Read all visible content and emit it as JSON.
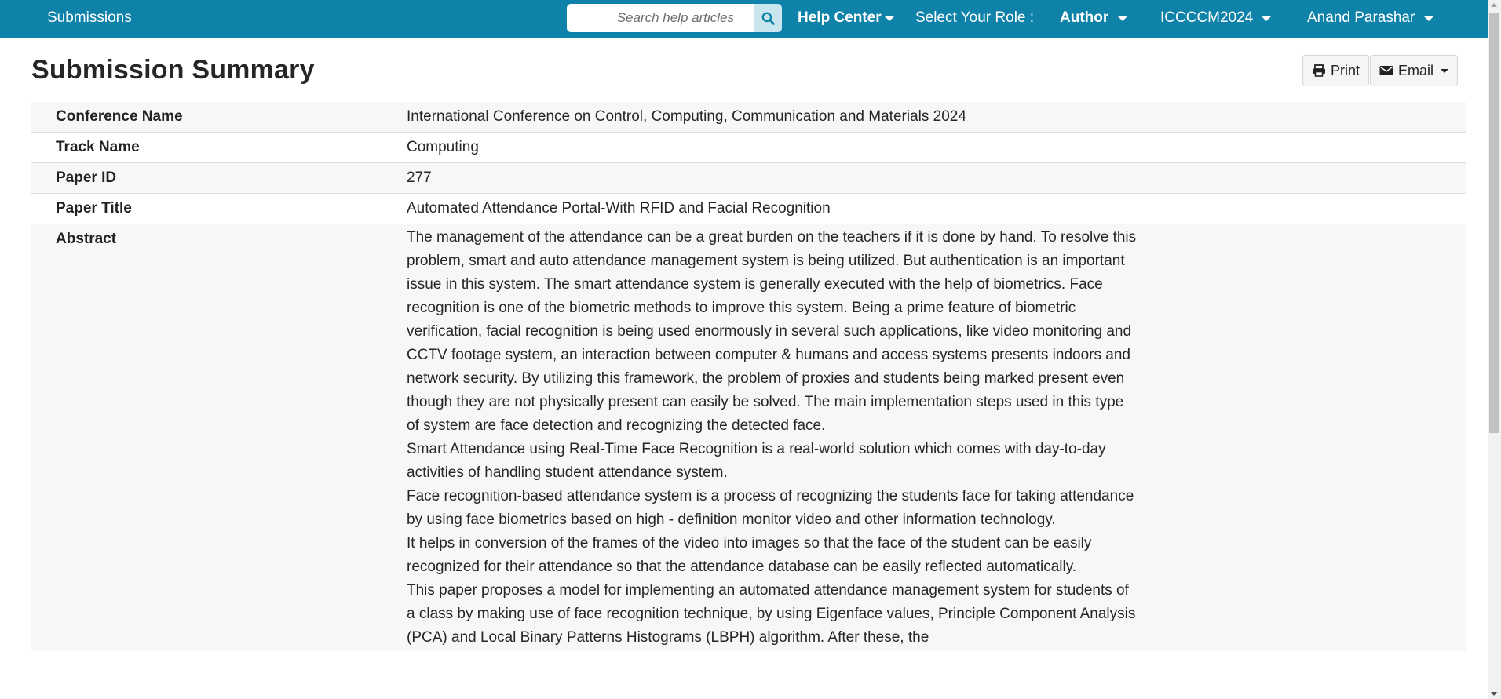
{
  "navbar": {
    "brand": "Submissions",
    "search_placeholder": "Search help articles",
    "help_center": "Help Center",
    "role_label": "Select Your Role :",
    "role_value": "Author",
    "conference": "ICCCCM2024",
    "user": "Anand Parashar",
    "background_color": "#0f82a9"
  },
  "page": {
    "title": "Submission Summary",
    "print_label": "Print",
    "email_label": "Email"
  },
  "summary": {
    "rows": [
      {
        "label": "Conference Name",
        "value": "International Conference on Control, Computing, Communication and Materials 2024"
      },
      {
        "label": "Track Name",
        "value": "Computing"
      },
      {
        "label": "Paper ID",
        "value": "277"
      },
      {
        "label": "Paper Title",
        "value": "Automated Attendance Portal-With RFID and Facial Recognition"
      }
    ],
    "abstract": {
      "label": "Abstract",
      "paragraphs": [
        "The management of the attendance can be a great burden on the teachers if it is done by hand. To resolve this problem, smart and auto attendance management system is being utilized. But authentication is an important issue in this system. The smart attendance system is generally executed with the help of biometrics. Face recognition is one of the biometric methods to improve this system. Being a prime feature of biometric verification, facial recognition is being used enormously in several such applications, like video monitoring and CCTV footage system, an interaction between computer & humans and access systems presents indoors and network security. By utilizing this framework, the problem of proxies and students being marked present even though they are not physically present can easily be solved. The main implementation steps used in this type of system are face detection and recognizing the detected face.",
        "Smart Attendance using Real-Time Face Recognition is a real-world solution which comes with day-to-day activities of handling student attendance system.",
        "Face recognition-based attendance system is a process of recognizing the students face for taking attendance by using face biometrics based on high - definition monitor video and other information technology.",
        "It helps in conversion of the frames of the video into images so that the face of the student can be easily recognized for their attendance so that the attendance database can be easily reflected automatically.",
        "This paper proposes a model for implementing an automated attendance management system for students of a class by making use of face recognition technique, by using Eigenface values, Principle Component Analysis (PCA) and Local Binary Patterns Histograms (LBPH) algorithm. After these, the"
      ]
    }
  },
  "icons": {
    "search": "search-icon",
    "print": "print-icon",
    "email": "envelope-icon"
  }
}
